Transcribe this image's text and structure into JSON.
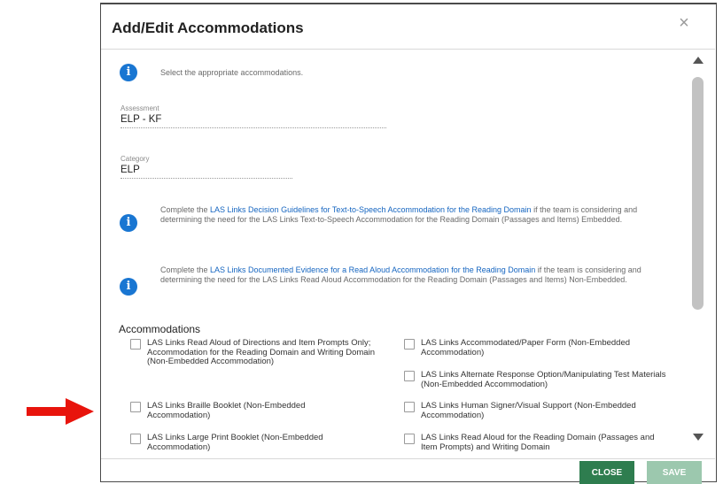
{
  "dialog": {
    "title": "Add/Edit Accommodations",
    "close_icon": "×",
    "info_icon_glyph": "i",
    "intro": "Select the appropriate accommodations.",
    "assessment": {
      "label": "Assessment",
      "value": "ELP - KF"
    },
    "category": {
      "label": "Category",
      "value": "ELP"
    },
    "notice1": {
      "prefix": "Complete the ",
      "link": "LAS Links Decision Guidelines for Text-to-Speech Accommodation for the Reading Domain",
      "suffix": " if the team is considering and determining the need for the LAS Links Text-to-Speech Accommodation for the Reading Domain (Passages and Items) Embedded."
    },
    "notice2": {
      "prefix": "Complete the ",
      "link": "LAS Links Documented Evidence for a Read Aloud Accommodation for the Reading Domain",
      "suffix": " if the team is considering and determining the need for the LAS Links Read Aloud Accommodation for the Reading Domain (Passages and Items) Non-Embedded."
    },
    "accommodations_title": "Accommodations",
    "accommodations": [
      {
        "label": "LAS Links Read Aloud of Directions and Item Prompts Only; Accommodation for the Reading Domain and Writing Domain (Non-Embedded Accommodation)",
        "checked": false
      },
      {
        "label": "LAS Links Accommodated/Paper Form (Non-Embedded Accommodation)",
        "checked": false
      },
      {
        "label": "LAS Links Alternate Response Option/Manipulating Test Materials (Non-Embedded Accommodation)",
        "checked": false
      },
      {
        "label": "LAS Links Braille Booklet (Non-Embedded Accommodation)",
        "checked": false
      },
      {
        "label": "LAS Links Human Signer/Visual Support (Non-Embedded Accommodation)",
        "checked": false
      },
      {
        "label": "LAS Links Large Print Booklet (Non-Embedded Accommodation)",
        "checked": false
      },
      {
        "label": "LAS Links Read Aloud for the Reading Domain (Passages and Item Prompts) and Writing Domain",
        "checked": false
      }
    ],
    "buttons": {
      "close": "CLOSE",
      "save": "SAVE"
    }
  },
  "colors": {
    "accent_blue": "#1976d2",
    "link_blue": "#1565c0",
    "close_button_green": "#2e7d4f",
    "save_button_disabled_green": "#9cc8ae",
    "arrow_red": "#e8140c"
  },
  "icons": [
    "right-arrow-icon",
    "close-icon",
    "info-icon",
    "scroll-up-icon",
    "scroll-down-icon"
  ]
}
